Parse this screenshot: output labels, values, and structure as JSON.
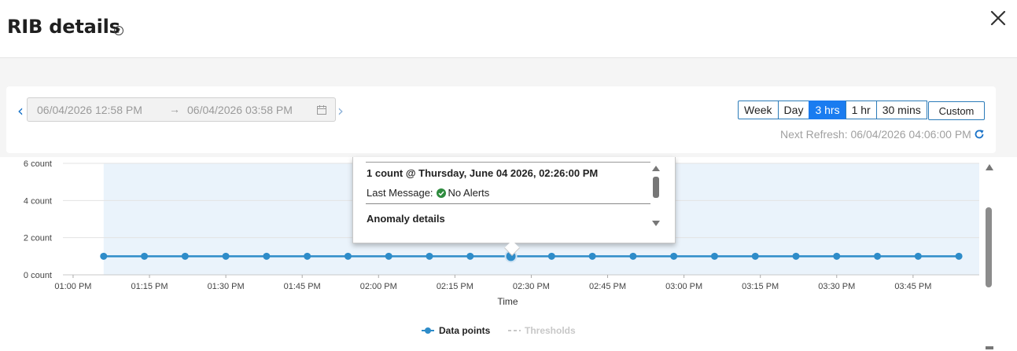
{
  "header": {
    "title": "RIB details"
  },
  "date_range": {
    "start": "06/04/2026 12:58 PM",
    "separator": "→",
    "end": "06/04/2026 03:58 PM"
  },
  "periods": [
    {
      "label": "Week",
      "active": false
    },
    {
      "label": "Day",
      "active": false
    },
    {
      "label": "3 hrs",
      "active": true
    },
    {
      "label": "1 hr",
      "active": false
    },
    {
      "label": "30 mins",
      "active": false
    }
  ],
  "custom_label": "Custom",
  "next_refresh": "Next Refresh: 06/04/2026 04:06:00 PM",
  "tooltip": {
    "heading": "1 count @ Thursday, June 04 2026, 02:26:00 PM",
    "last_message_label": "Last Message:",
    "last_message_value": "No Alerts",
    "anomaly_label": "Anomaly details"
  },
  "colors": {
    "accent": "#1a7cf0",
    "series": "#2e8cc9",
    "band": "#eaf3fb",
    "threshold": "#c8c8c8",
    "ok": "#2e8b3e"
  },
  "chart_data": {
    "type": "line",
    "xlabel": "Time",
    "ylabel": "",
    "y_ticks": [
      "0 count",
      "2 count",
      "4 count",
      "6 count"
    ],
    "ylim": [
      0,
      6
    ],
    "x_ticks": [
      "01:00 PM",
      "01:15 PM",
      "01:30 PM",
      "01:45 PM",
      "02:00 PM",
      "02:15 PM",
      "02:30 PM",
      "02:45 PM",
      "03:00 PM",
      "03:15 PM",
      "03:30 PM",
      "03:45 PM"
    ],
    "x_range": [
      "12:58 PM",
      "03:58 PM"
    ],
    "data_window": [
      "01:06 PM",
      "03:58 PM"
    ],
    "legend": {
      "position": "bottom-center"
    },
    "series": [
      {
        "name": "Data points",
        "x": [
          "01:06 PM",
          "01:14 PM",
          "01:22 PM",
          "01:30 PM",
          "01:38 PM",
          "01:46 PM",
          "01:54 PM",
          "02:02 PM",
          "02:10 PM",
          "02:18 PM",
          "02:26 PM",
          "02:34 PM",
          "02:42 PM",
          "02:50 PM",
          "02:58 PM",
          "03:06 PM",
          "03:14 PM",
          "03:22 PM",
          "03:30 PM",
          "03:38 PM",
          "03:46 PM",
          "03:54 PM"
        ],
        "values": [
          1,
          1,
          1,
          1,
          1,
          1,
          1,
          1,
          1,
          1,
          1,
          1,
          1,
          1,
          1,
          1,
          1,
          1,
          1,
          1,
          1,
          1
        ],
        "highlighted": "02:26 PM"
      },
      {
        "name": "Thresholds",
        "values": []
      }
    ]
  }
}
